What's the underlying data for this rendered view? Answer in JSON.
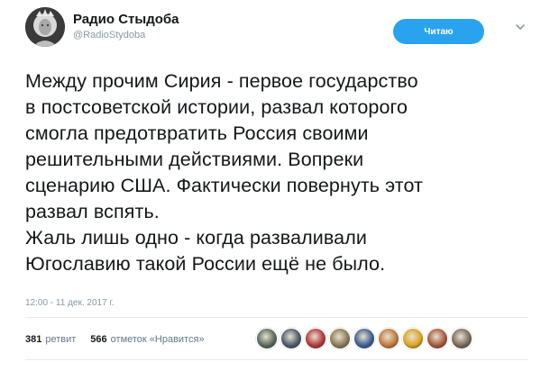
{
  "author": {
    "name": "Радио Стыдоба",
    "handle": "@RadioStydoba"
  },
  "follow_button": {
    "label": "Читаю"
  },
  "tweet": {
    "lines": [
      "Между прочим Сирия - первое государство",
      "в постсоветской истории, развал которого",
      "смогла предотвратить Россия своими",
      "решительными действиями. Вопреки",
      "сценарию США. Фактически повернуть этот",
      "развал вспять.",
      "Жаль лишь одно - когда разваливали",
      "Югославию такой России ещё не было."
    ],
    "timestamp": "12:00 - 11 дек. 2017 г."
  },
  "stats": {
    "retweets_count": "381",
    "retweets_label": "ретвит",
    "likes_count": "566",
    "likes_label": "отметок «Нравится»"
  },
  "icons": {
    "avatar": "statue-avatar-icon",
    "caret": "chevron-down-icon"
  },
  "colors": {
    "follow_button_bg": "#2aa3ef",
    "handle_gray": "#8899a6",
    "liker_avatars": [
      "#5a6b5a",
      "#4d5a6a",
      "#b23a3a",
      "#8a7a55",
      "#3f5f8f",
      "#c07a3a",
      "#d9a520",
      "#a55a3a",
      "#7a6a5a"
    ]
  }
}
